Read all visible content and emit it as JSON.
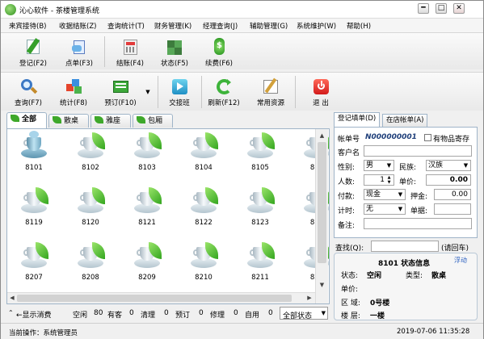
{
  "window": {
    "title": "沁心软件 - 茶楼管理系统",
    "controls": [
      "━",
      "□",
      "✕"
    ]
  },
  "menu": [
    "来宾接待(B)",
    "收据结账(Z)",
    "查询统计(T)",
    "财务管理(K)",
    "经理查询(J)",
    "辅助管理(G)",
    "系统维护(W)",
    "帮助(H)"
  ],
  "toolbar1": [
    {
      "label": "登记(F2)",
      "icon": "register-icon"
    },
    {
      "label": "点单(F3)",
      "icon": "order-icon"
    },
    {
      "label": "结账(F4)",
      "icon": "checkout-icon"
    },
    {
      "label": "状态(F5)",
      "icon": "status-icon"
    },
    {
      "label": "续费(F6)",
      "icon": "renew-icon"
    }
  ],
  "toolbar2": [
    {
      "label": "查询(F7)",
      "icon": "search-icon"
    },
    {
      "label": "统计(F8)",
      "icon": "stats-icon"
    },
    {
      "label": "预订(F10)",
      "icon": "reserve-icon"
    },
    {
      "label": "交接班",
      "icon": "handover-icon"
    },
    {
      "label": "刷新(F12)",
      "icon": "refresh-icon"
    },
    {
      "label": "常用资源",
      "icon": "resources-icon"
    },
    {
      "label": "退  出",
      "icon": "exit-icon"
    }
  ],
  "area_tabs": [
    "全部",
    "散桌",
    "雅座",
    "包厢"
  ],
  "tables": [
    {
      "num": "8101",
      "status": "busy"
    },
    {
      "num": "8102",
      "status": "free"
    },
    {
      "num": "8103",
      "status": "free"
    },
    {
      "num": "8104",
      "status": "free"
    },
    {
      "num": "8105",
      "status": "free"
    },
    {
      "num": "810",
      "status": "free"
    },
    {
      "num": "8119",
      "status": "free"
    },
    {
      "num": "8120",
      "status": "free"
    },
    {
      "num": "8121",
      "status": "free"
    },
    {
      "num": "8122",
      "status": "free"
    },
    {
      "num": "8123",
      "status": "free"
    },
    {
      "num": "812",
      "status": "free"
    },
    {
      "num": "8207",
      "status": "free"
    },
    {
      "num": "8208",
      "status": "free"
    },
    {
      "num": "8209",
      "status": "free"
    },
    {
      "num": "8210",
      "status": "free"
    },
    {
      "num": "8211",
      "status": "free"
    },
    {
      "num": "821",
      "status": "free"
    }
  ],
  "status_summary": {
    "show_consume": "显示消费",
    "idle_label": "空闲",
    "idle": "80",
    "occupied_label": "有客",
    "occupied": "0",
    "cleaning_label": "清理",
    "cleaning": "0",
    "reserved_label": "预订",
    "reserved": "0",
    "repair_label": "修理",
    "repair": "0",
    "self_label": "自用",
    "self": "0",
    "filter_value": "全部状态"
  },
  "right_tabs": [
    "登记填单(D)",
    "在店帐单(A)"
  ],
  "register_form": {
    "account_label": "帐单号",
    "account_no": "N000000001",
    "deposit_label": "有物品寄存",
    "customer_label": "客户名",
    "customer_value": "",
    "gender_label": "性别:",
    "gender_value": "男",
    "ethnic_label": "民族:",
    "ethnic_value": "汉族",
    "people_label": "人数:",
    "people_value": "1",
    "price_label": "单价:",
    "price_value": "0.00",
    "payment_label": "付款:",
    "payment_value": "现金",
    "deposit_money_label": "押金:",
    "deposit_money_value": "0.00",
    "timing_label": "计时:",
    "timing_value": "无",
    "receipt_label": "单据:",
    "receipt_value": "",
    "remark_label": "备注:",
    "remark_value": ""
  },
  "find": {
    "label": "查找(Q):",
    "value": "",
    "hint": "(请回车)"
  },
  "info_panel": {
    "title": "8101 状态信息",
    "float_label": "浮动",
    "state_label": "状态:",
    "state_value": "空闲",
    "type_label": "类型:",
    "type_value": "散桌",
    "price_label": "单价:",
    "price_value": "",
    "area_label": "区  域:",
    "area_value": "0号楼",
    "floor_label": "楼  层:",
    "floor_value": "一楼"
  },
  "bottom": {
    "operator": "当前操作：系统管理员",
    "datetime": "2019-07-06 11:35:28"
  },
  "colors": {
    "accent_blue": "#1f56a5",
    "leaf_green": "#3ea82a",
    "panel_border": "#9fb4c8"
  }
}
